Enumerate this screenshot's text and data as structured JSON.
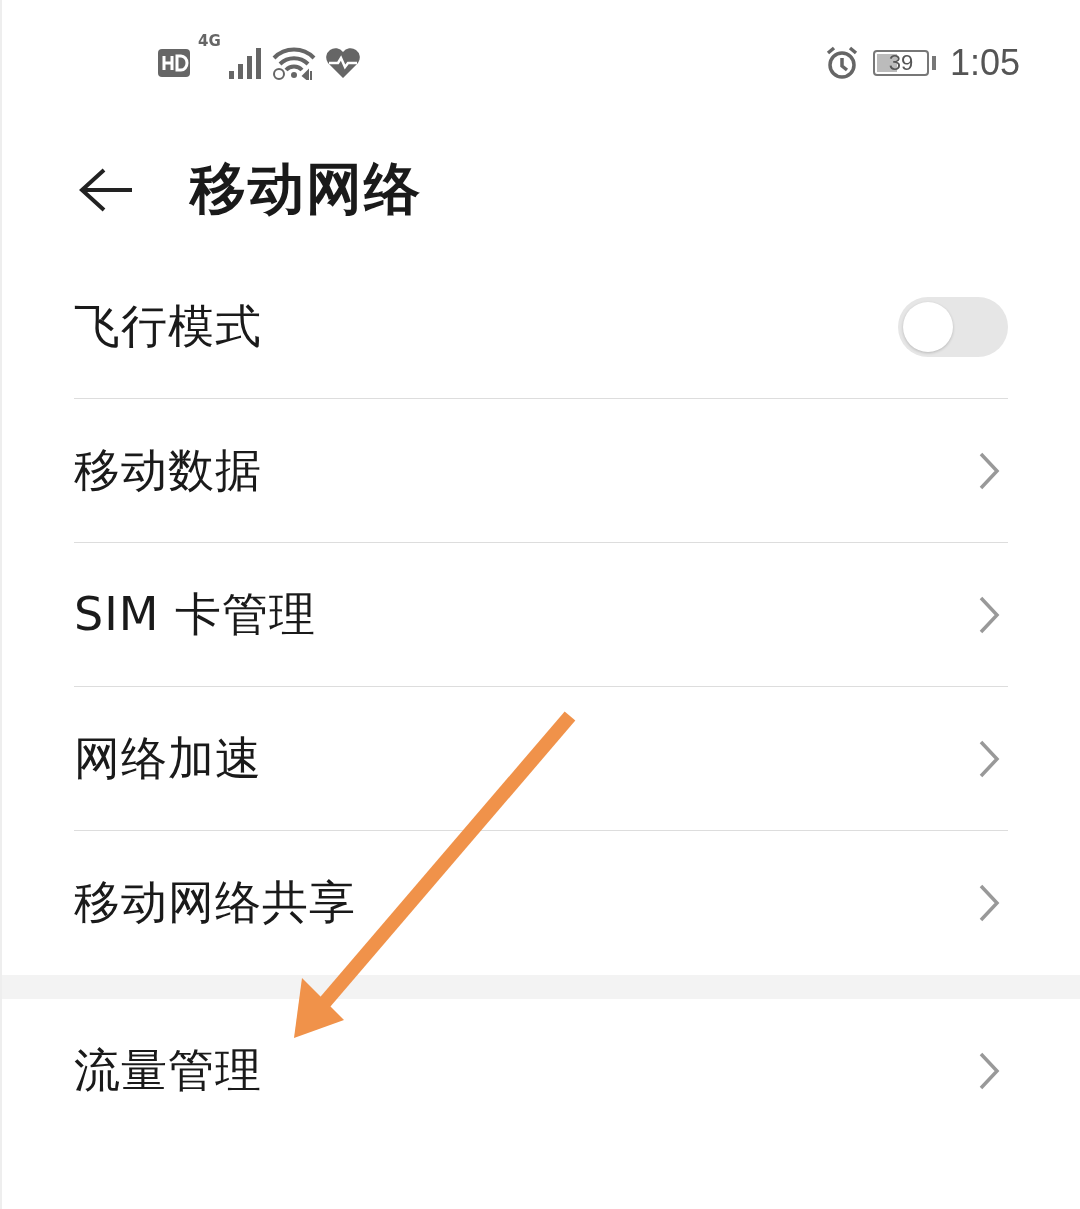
{
  "status_bar": {
    "network": "4G",
    "battery": "39",
    "time": "1:05"
  },
  "header": {
    "title": "移动网络"
  },
  "sections": [
    {
      "items": [
        {
          "kind": "toggle",
          "label": "飞行模式",
          "on": false
        },
        {
          "kind": "link",
          "label": "移动数据"
        },
        {
          "kind": "link",
          "label": "SIM 卡管理"
        },
        {
          "kind": "link",
          "label": "网络加速"
        },
        {
          "kind": "link",
          "label": "移动网络共享"
        }
      ]
    },
    {
      "items": [
        {
          "kind": "link",
          "label": "流量管理"
        }
      ]
    }
  ]
}
